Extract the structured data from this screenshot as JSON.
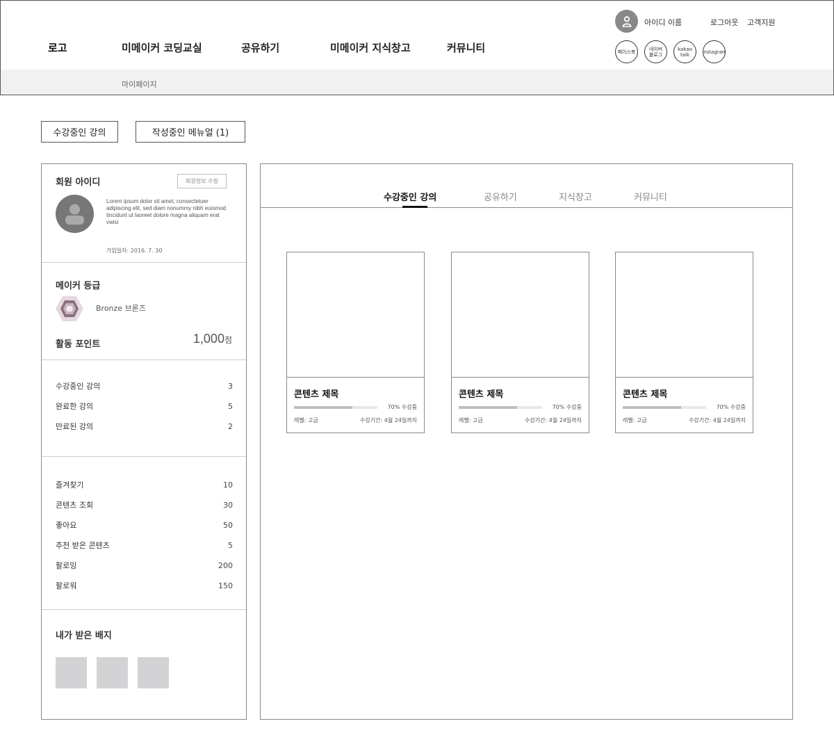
{
  "header": {
    "logo": "로고",
    "nav": [
      "미메이커 코딩교실",
      "공유하기",
      "미메이커 지식창고",
      "커뮤니티"
    ],
    "user_name": "아이디 이름",
    "logout": "로그아웃",
    "support": "고객지원",
    "sns": [
      "페이스북",
      "네이버\n블로그",
      "kakao\ntalk",
      "instagram"
    ]
  },
  "breadcrumb": "마이페이지",
  "top_buttons": [
    "수강중인 강의",
    "작성중인 메뉴얼 (1)"
  ],
  "sidebar": {
    "member_title": "회원 아이디",
    "edit_button": "회원정보 수정",
    "intro": "Lorem ipsum dolor sit amet, consectetuer adipiscing elit, sed diam nonummy nibh euismod tincidunt ut laoreet dolore magna aliquam erat vwisi",
    "join_date": "가입일자: 2016. 7. 30",
    "grade_title": "메이커 등급",
    "grade_name": "Bronze 브론즈",
    "point_label": "활동 포인트",
    "point_value": "1,000",
    "point_unit": "점",
    "course_stats": [
      {
        "label": "수강중인 강의",
        "value": "3"
      },
      {
        "label": "완료한 강의",
        "value": "5"
      },
      {
        "label": "만료된 강의",
        "value": "2"
      }
    ],
    "activity_stats": [
      {
        "label": "즐겨찾기",
        "value": "10"
      },
      {
        "label": "콘텐츠 조회",
        "value": "30"
      },
      {
        "label": "좋아요",
        "value": "50"
      },
      {
        "label": "추천 받은 콘텐츠",
        "value": "5"
      },
      {
        "label": "팔로잉",
        "value": "200"
      },
      {
        "label": "팔로워",
        "value": "150"
      }
    ],
    "badge_title": "내가 받은 배지"
  },
  "main": {
    "tabs": [
      "수강중인 강의",
      "공유하기",
      "지식창고",
      "커뮤니티"
    ],
    "cards": [
      {
        "title": "콘텐츠 제목",
        "progress": 0.7,
        "progress_text": "70% 수강중",
        "level": "레벨: 고급",
        "period": "수강기간: 4월 24일까지"
      },
      {
        "title": "콘텐츠 제목",
        "progress": 0.7,
        "progress_text": "70% 수강중",
        "level": "레벨: 고급",
        "period": "수강기간: 4월 24일까지"
      },
      {
        "title": "콘텐츠 제목",
        "progress": 0.7,
        "progress_text": "70% 수강중",
        "level": "레벨: 고급",
        "period": "수강기간: 4월 24일까지"
      }
    ]
  },
  "colors": {
    "border": "#555555",
    "subbar": "#f1f1f1",
    "avatar": "#888888",
    "badge_placeholder": "#d3d3d5",
    "grade_icon": "#c9b3bf",
    "progress_fill": "#bdbdbd"
  },
  "icons": {
    "user": "user-icon",
    "profile": "profile-silhouette-icon",
    "grade": "hexagon-gem-icon"
  }
}
